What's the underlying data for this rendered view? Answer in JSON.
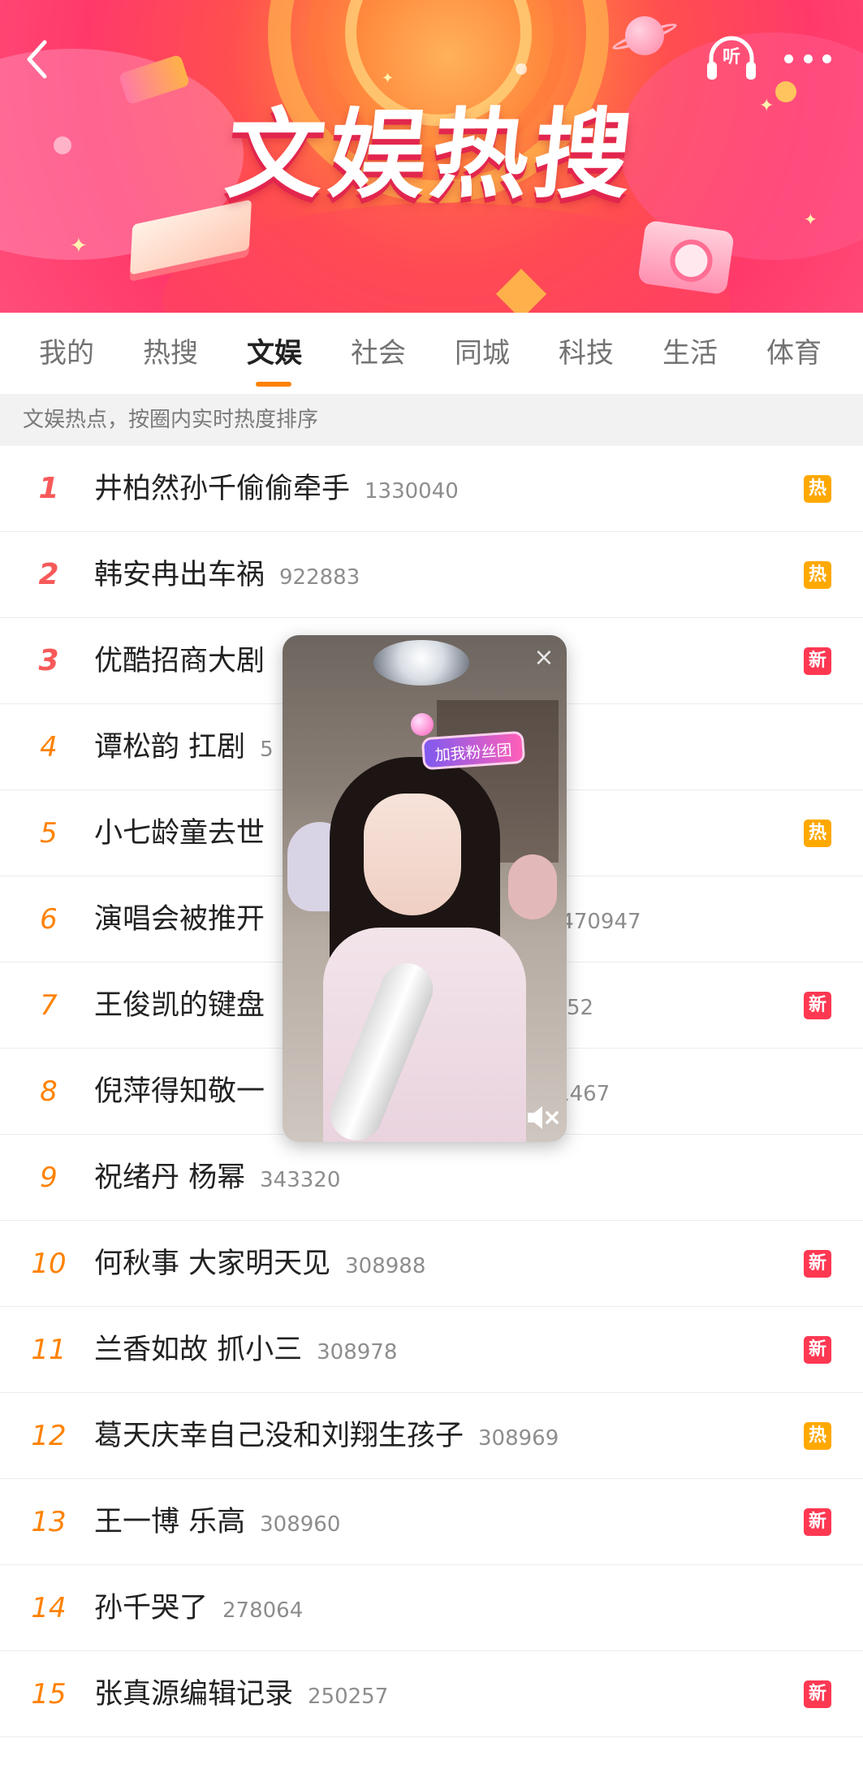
{
  "header": {
    "title": "文娱热搜",
    "listen_label": "听"
  },
  "tabs": [
    {
      "label": "我的",
      "active": false
    },
    {
      "label": "热搜",
      "active": false
    },
    {
      "label": "文娱",
      "active": true
    },
    {
      "label": "社会",
      "active": false
    },
    {
      "label": "同城",
      "active": false
    },
    {
      "label": "科技",
      "active": false
    },
    {
      "label": "生活",
      "active": false
    },
    {
      "label": "体育",
      "active": false
    }
  ],
  "subheader": "文娱热点，按圈内实时热度排序",
  "list": [
    {
      "rank": "1",
      "title": "井柏然孙千偷偷牵手",
      "heat": "1330040",
      "badge": "热",
      "badge_type": "hot"
    },
    {
      "rank": "2",
      "title": "韩安冉出车祸",
      "heat": "922883",
      "badge": "热",
      "badge_type": "hot"
    },
    {
      "rank": "3",
      "title": "优酷招商大剧",
      "heat": "",
      "badge": "新",
      "badge_type": "new"
    },
    {
      "rank": "4",
      "title": "谭松韵 扛剧",
      "heat": "5",
      "badge": "",
      "badge_type": "none"
    },
    {
      "rank": "5",
      "title": "小七龄童去世",
      "heat": "",
      "badge": "热",
      "badge_type": "hot"
    },
    {
      "rank": "6",
      "title": "演唱会被推开",
      "heat": "手  470947",
      "badge": "",
      "badge_type": "none"
    },
    {
      "rank": "7",
      "title": "王俊凯的键盘",
      "heat": "52",
      "badge": "新",
      "badge_type": "new"
    },
    {
      "rank": "8",
      "title": "倪萍得知敬一",
      "heat": "381467",
      "badge": "",
      "badge_type": "none"
    },
    {
      "rank": "9",
      "title": "祝绪丹 杨幂",
      "heat": "343320",
      "badge": "",
      "badge_type": "none"
    },
    {
      "rank": "10",
      "title": "何秋事 大家明天见",
      "heat": "308988",
      "badge": "新",
      "badge_type": "new"
    },
    {
      "rank": "11",
      "title": "兰香如故 抓小三",
      "heat": "308978",
      "badge": "新",
      "badge_type": "new"
    },
    {
      "rank": "12",
      "title": "葛天庆幸自己没和刘翔生孩子",
      "heat": "308969",
      "badge": "热",
      "badge_type": "hot"
    },
    {
      "rank": "13",
      "title": "王一博 乐高",
      "heat": "308960",
      "badge": "新",
      "badge_type": "new"
    },
    {
      "rank": "14",
      "title": "孙千哭了",
      "heat": "278064",
      "badge": "",
      "badge_type": "none"
    },
    {
      "rank": "15",
      "title": "张真源编辑记录",
      "heat": "250257",
      "badge": "新",
      "badge_type": "new"
    }
  ],
  "video": {
    "tag_label": "加我粉丝团",
    "close_label": "×"
  }
}
